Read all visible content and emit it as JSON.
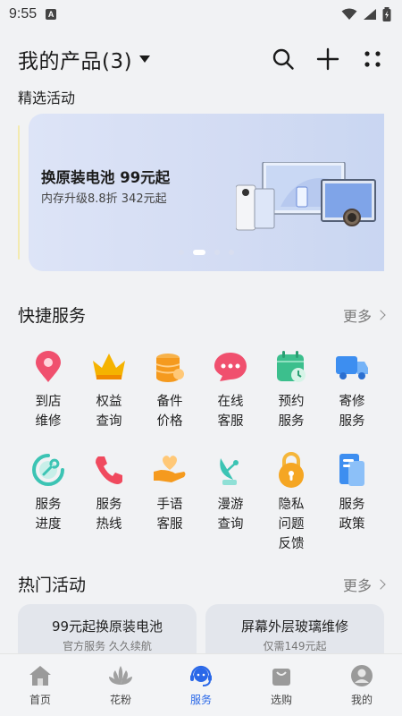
{
  "status_bar": {
    "time": "9:55",
    "notif_icon": "A"
  },
  "header": {
    "title": "我的产品(3)",
    "icons": [
      "search-icon",
      "plus-icon",
      "more-dots-icon"
    ]
  },
  "featured": {
    "label": "精选活动",
    "banner": {
      "title": "换原装电池 99元起",
      "subtitle": "内存升级8.8折 342元起",
      "page_count": 4,
      "active_page": 1
    }
  },
  "quick_services": {
    "title": "快捷服务",
    "more": "更多",
    "items": [
      {
        "label": "到店维修",
        "icon": "location-pin-icon",
        "color": "#f0506e"
      },
      {
        "label": "权益查询",
        "icon": "crown-icon",
        "color": "#f5b300"
      },
      {
        "label": "备件价格",
        "icon": "coins-icon",
        "color": "#f59a1e"
      },
      {
        "label": "在线客服",
        "icon": "chat-bubble-icon",
        "color": "#f0506e"
      },
      {
        "label": "预约服务",
        "icon": "calendar-clock-icon",
        "color": "#3cbf8d"
      },
      {
        "label": "寄修服务",
        "icon": "truck-icon",
        "color": "#3d8ef0"
      },
      {
        "label": "服务进度",
        "icon": "progress-wrench-icon",
        "color": "#3cc4b4"
      },
      {
        "label": "服务热线",
        "icon": "phone-icon",
        "color": "#f04a5e"
      },
      {
        "label": "手语客服",
        "icon": "heart-hand-icon",
        "color": "#f59a1e"
      },
      {
        "label": "漫游查询",
        "icon": "satellite-icon",
        "color": "#3cc4b4"
      },
      {
        "label": "隐私问题反馈",
        "icon": "lock-icon",
        "color": "#f5a623"
      },
      {
        "label": "服务政策",
        "icon": "document-icon",
        "color": "#3d8ef0"
      }
    ]
  },
  "hot_activities": {
    "title": "热门活动",
    "more": "更多",
    "cards": [
      {
        "title": "99元起换原装电池",
        "subtitle": "官方服务 久久续航"
      },
      {
        "title": "屏幕外层玻璃维修",
        "subtitle": "仅需149元起"
      }
    ]
  },
  "tabbar": {
    "tabs": [
      {
        "label": "首页",
        "icon": "home-icon",
        "active": false
      },
      {
        "label": "花粉",
        "icon": "flower-icon",
        "active": false
      },
      {
        "label": "服务",
        "icon": "service-headset-icon",
        "active": true
      },
      {
        "label": "选购",
        "icon": "shopping-bag-icon",
        "active": false
      },
      {
        "label": "我的",
        "icon": "avatar-icon",
        "active": false
      }
    ]
  },
  "colors": {
    "accent": "#2a68e8",
    "background": "#f1f2f4"
  }
}
